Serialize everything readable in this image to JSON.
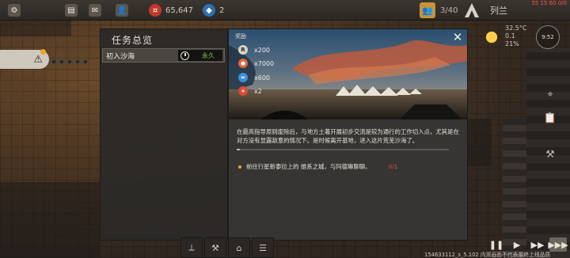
{
  "hud": {
    "coins": "65,647",
    "tokens": "2",
    "population": "3/40",
    "player_name": "列兰",
    "top_right_clock": "55 15 60 0/0",
    "resource_color": "#c7933a",
    "icons": [
      "chat-icon",
      "mail-icon",
      "profile-icon",
      "coin-icon",
      "token-icon",
      "population-icon",
      "faction-logo-icon"
    ]
  },
  "weather": {
    "temperature": "32.5°C",
    "wind": "0.1",
    "humidity": "21%",
    "time": "9:52",
    "icon": "sun-icon"
  },
  "task_panel": {
    "title": "任务总览",
    "tasks": [
      {
        "name": "初入沙海",
        "duration": "永久"
      }
    ]
  },
  "detail": {
    "reward_label": "奖励",
    "rewards": [
      {
        "icon": "reputation-icon",
        "amount": "x200",
        "color": "#d8d2c8"
      },
      {
        "icon": "food-icon",
        "amount": "x7000",
        "color": "#e3643a"
      },
      {
        "icon": "water-icon",
        "amount": "x600",
        "color": "#3a8fe3"
      },
      {
        "icon": "medkit-icon",
        "amount": "x2",
        "color": "#d84a3a"
      }
    ],
    "description": "在最高指导原则废除后，与地方土著开展初步交流是较为通行的工作切入点，尤其是在对方没有显露敌意的情况下。是时候离开基地，进入这片荒芜沙海了。",
    "objective_text": "前往行星新泰拉上的 维系之城，与玛德琳聊聊。",
    "objective_progress": "0/1",
    "close_label": "✕"
  },
  "speed_controls": [
    "❚❚",
    "▶",
    "▶▶",
    "▶▶▶"
  ],
  "version_text": "154633112_s_5.102 内测画面不代表最终上线品质"
}
